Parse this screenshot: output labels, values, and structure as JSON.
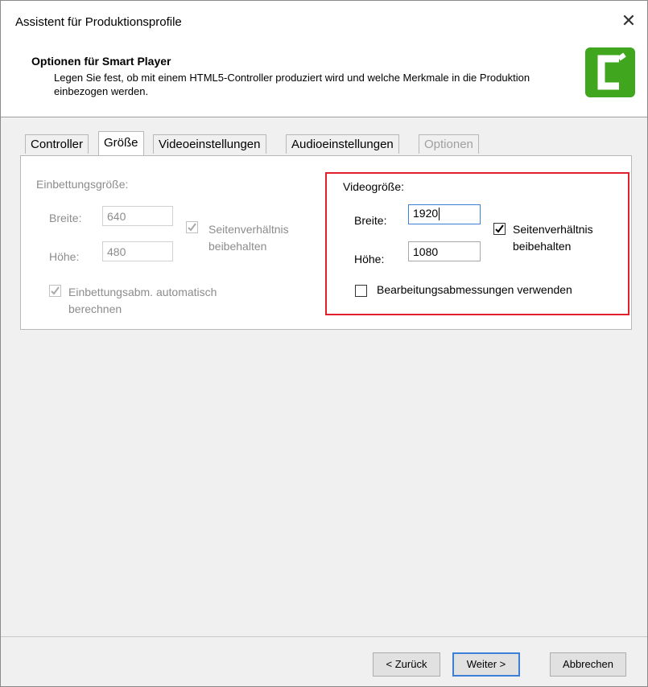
{
  "window": {
    "title": "Assistent für Produktionsprofile",
    "close_glyph": "✕"
  },
  "header": {
    "title": "Optionen für Smart Player",
    "description": "Legen Sie fest, ob mit einem HTML5-Controller produziert wird und welche Merkmale in die Produktion einbezogen werden.",
    "logo_icon": "camtasia-logo-icon",
    "logo_color": "#3fa61e"
  },
  "tabs": [
    {
      "label": "Controller",
      "state": "normal"
    },
    {
      "label": "Größe",
      "state": "active"
    },
    {
      "label": "Videoeinstellungen",
      "state": "normal"
    },
    {
      "label": "Audioeinstellungen",
      "state": "normal"
    },
    {
      "label": "Optionen",
      "state": "disabled"
    }
  ],
  "embed": {
    "heading": "Einbettungsgröße:",
    "width_label": "Breite:",
    "width_value": "640",
    "height_label": "Höhe:",
    "height_value": "480",
    "keep_ratio_label": "Seitenverhältnis beibehalten",
    "keep_ratio_checked": true,
    "auto_calc_label": "Einbettungsabm. automatisch berechnen",
    "auto_calc_checked": true,
    "enabled": false
  },
  "video": {
    "heading": "Videogröße:",
    "width_label": "Breite:",
    "width_value": "1920",
    "height_label": "Höhe:",
    "height_value": "1080",
    "keep_ratio_label": "Seitenverhältnis beibehalten",
    "keep_ratio_checked": true,
    "use_edit_dims_label": "Bearbeitungsabmessungen verwenden",
    "use_edit_dims_checked": false
  },
  "highlight_color": "#e0202c",
  "buttons": {
    "back": "< Zurück",
    "next": "Weiter >",
    "cancel": "Abbrechen"
  }
}
